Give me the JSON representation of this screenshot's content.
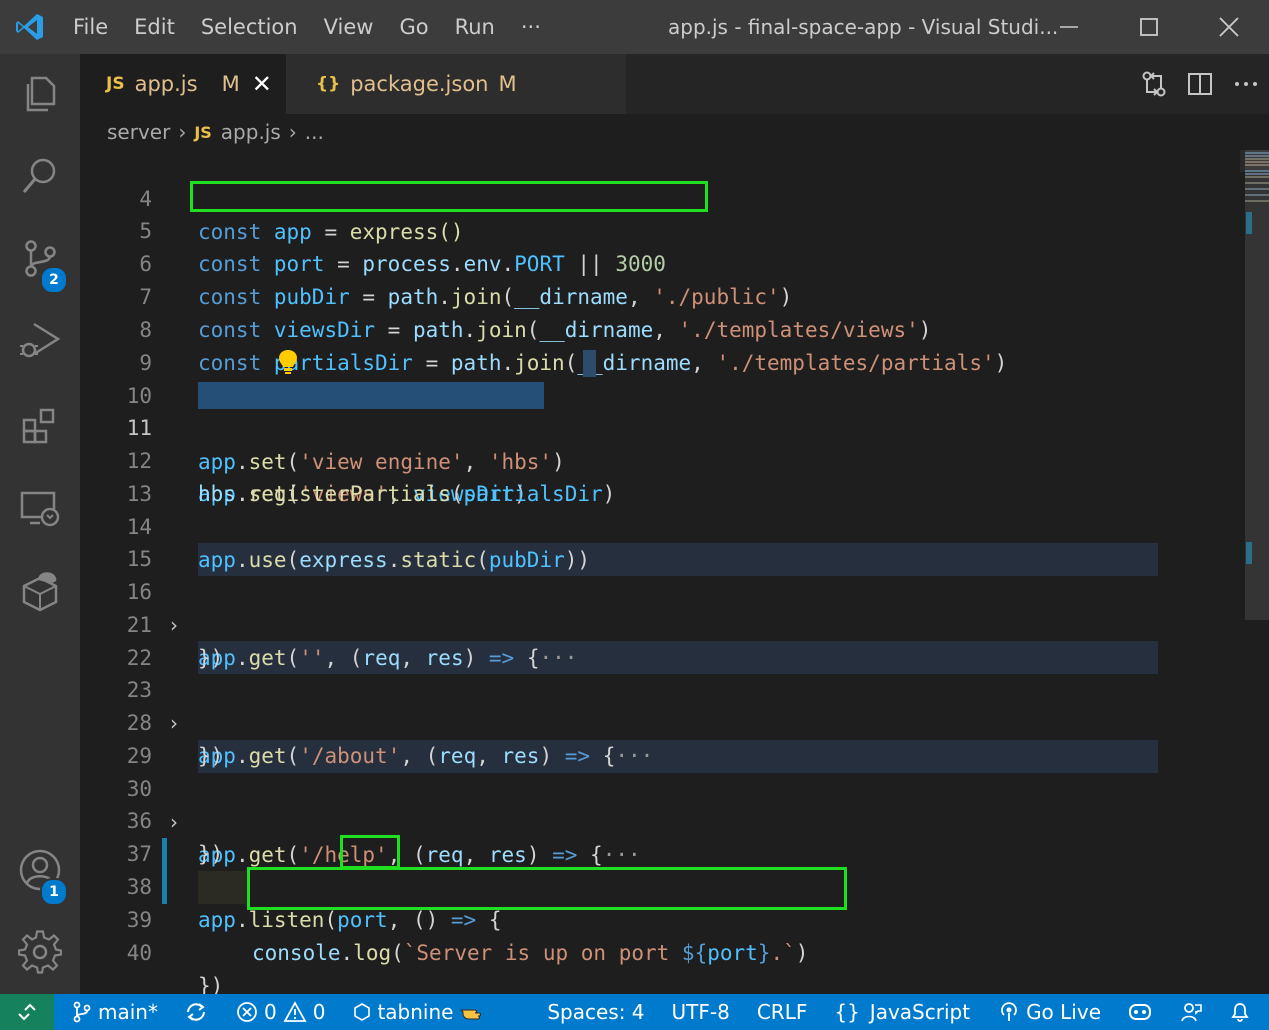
{
  "titlebar": {
    "menu": [
      "File",
      "Edit",
      "Selection",
      "View",
      "Go",
      "Run",
      "···"
    ],
    "window_title": "app.js - final-space-app - Visual Studi...",
    "minimize": "—",
    "maximize": "☐",
    "close": "✕"
  },
  "activitybar": {
    "scm_badge": "2",
    "accounts_badge": "1"
  },
  "tabs": [
    {
      "icon": "JS",
      "name": "app.js",
      "status": "M",
      "close": "✕",
      "active": true
    },
    {
      "icon": "{}",
      "name": "package.json",
      "status": "M",
      "active": false
    }
  ],
  "breadcrumb": {
    "folder": "server",
    "file_icon": "JS",
    "file": "app.js",
    "more": "..."
  },
  "editor": {
    "lines": [
      {
        "n": "4"
      },
      {
        "n": "5"
      },
      {
        "n": "6"
      },
      {
        "n": "7"
      },
      {
        "n": "8"
      },
      {
        "n": "9"
      },
      {
        "n": "10"
      },
      {
        "n": "11"
      },
      {
        "n": "12"
      },
      {
        "n": "13"
      },
      {
        "n": "14"
      },
      {
        "n": "15"
      },
      {
        "n": "16"
      },
      {
        "n": "21"
      },
      {
        "n": "22"
      },
      {
        "n": "23"
      },
      {
        "n": "28"
      },
      {
        "n": "29"
      },
      {
        "n": "30"
      },
      {
        "n": "36"
      },
      {
        "n": "37"
      },
      {
        "n": "38"
      },
      {
        "n": "39"
      },
      {
        "n": "40"
      }
    ],
    "tokens": {
      "const": "const",
      "app": "app",
      "express_call": "express()",
      "port": "port",
      "process": "process",
      "env": "env",
      "PORT": "PORT",
      "or": "||",
      "n3000": "3000",
      "pubDir": "pubDir",
      "viewsDir": "viewsDir",
      "partialsDir": "partialsDir",
      "path": "path",
      "join": "join",
      "dirname": "__dirname",
      "s_public": "'./public'",
      "s_views": "'./templates/views'",
      "s_partials": "'./templates/partials'",
      "set": "set",
      "s_view_engine": "'view engine'",
      "s_hbs": "'hbs'",
      "s_views_key": "'views'",
      "hbs": "hbs",
      "registerPartials": "registerPartials",
      "use": "use",
      "express": "express",
      "static": "static",
      "get": "get",
      "s_empty": "''",
      "s_about": "'/about'",
      "s_help": "'/help'",
      "req": "req",
      "res": "res",
      "arrow": "=>",
      "fold_ellipsis": "···",
      "close_brace": "})",
      "listen": "listen",
      "console": "console",
      "log": "log",
      "tpl_a": "`Server is up on port ",
      "tpl_open": "${",
      "tpl_close": "}",
      "tpl_b": ".`"
    }
  },
  "statusbar": {
    "branch": "main*",
    "errors": "0",
    "warnings": "0",
    "tabnine": "tabnine",
    "spaces": "Spaces: 4",
    "encoding": "UTF-8",
    "eol": "CRLF",
    "lang_icon": "{}",
    "language": "JavaScript",
    "golive": "Go Live"
  },
  "colors": {
    "accent": "#007acc",
    "remote": "#16825d",
    "highlight_box": "#1ee01e"
  }
}
